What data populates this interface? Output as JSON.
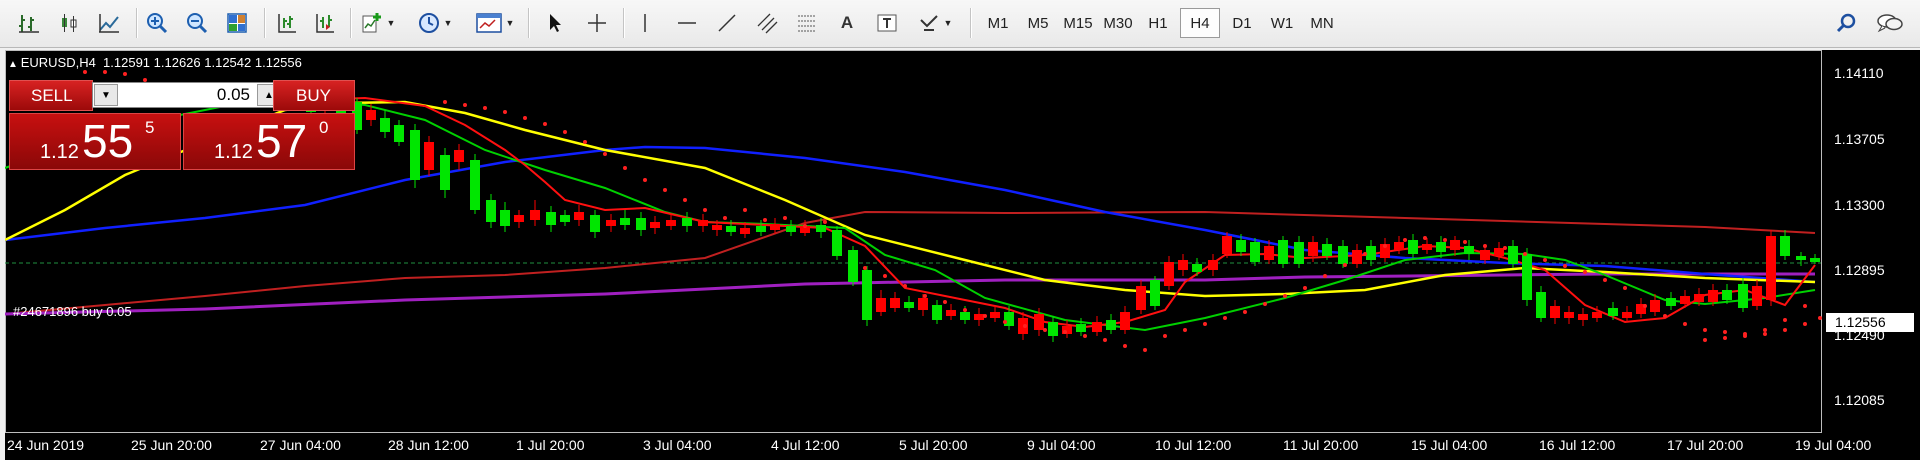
{
  "toolbar": {
    "timeframes": [
      "M1",
      "M5",
      "M15",
      "M30",
      "H1",
      "H4",
      "D1",
      "W1",
      "MN"
    ],
    "active_timeframe": "H4"
  },
  "symbol_bar": {
    "text": "EURUSD,H4  1.12591 1.12626 1.12542 1.12556"
  },
  "trade_panel": {
    "sell_label": "SELL",
    "buy_label": "BUY",
    "lot": "0.05",
    "sell_small": "1.12",
    "sell_big": "55",
    "sell_sup": "5",
    "buy_small": "1.12",
    "buy_big": "57",
    "buy_sup": "0",
    "spin_down": "▼",
    "spin_up": "▲"
  },
  "order_label": "#24671896 buy 0.05",
  "current_price": "1.12556",
  "price_axis": [
    "1.14110",
    "1.13705",
    "1.13300",
    "1.12895",
    "1.12490",
    "1.12085"
  ],
  "time_axis": [
    "24 Jun 2019",
    "25 Jun 20:00",
    "27 Jun 04:00",
    "28 Jun 12:00",
    "1 Jul 20:00",
    "3 Jul 04:00",
    "4 Jul 12:00",
    "5 Jul 20:00",
    "9 Jul 04:00",
    "10 Jul 12:00",
    "11 Jul 20:00",
    "15 Jul 04:00",
    "16 Jul 12:00",
    "17 Jul 20:00",
    "19 Jul 04:00"
  ],
  "colors": {
    "bull": "#00e600",
    "bear": "#ff0000",
    "ma_yellow": "#ffff00",
    "ma_blue": "#1020ff",
    "ma_green": "#00d000",
    "ma_red": "#ff1010",
    "ma_darkred": "#c02020",
    "ma_purple": "#a020c0",
    "sar": "#ff2020"
  }
}
